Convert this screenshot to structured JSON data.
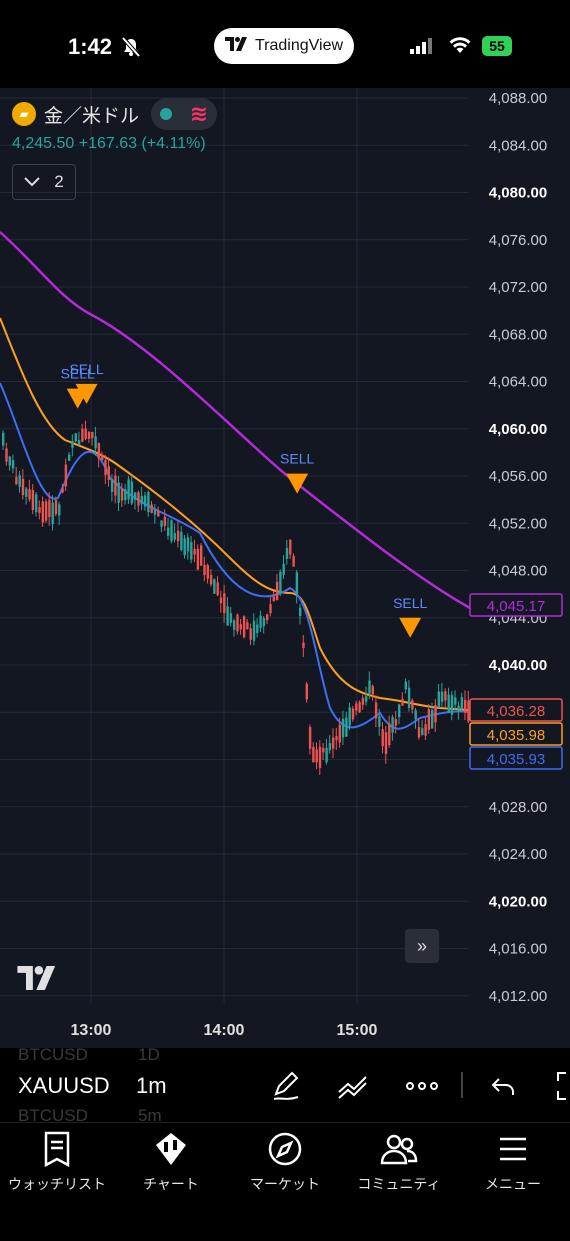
{
  "statusbar": {
    "time": "1:42",
    "app_pill": "TradingView",
    "battery": "55"
  },
  "legend": {
    "symbol_name": "金／米ドル",
    "last_price": "4,245.50",
    "change": "+167.63",
    "change_pct": "(+4.11%)",
    "indicators_count": "2"
  },
  "chart": {
    "colors": {
      "up": "#26a69a",
      "down": "#ef5350",
      "ema_fast": "#3d6ef5",
      "ema_mid": "#ff9f1a",
      "ema_slow": "#b32ad9",
      "grid": "#242936",
      "bg": "#131722"
    },
    "price_axis": [
      "4,088.00",
      "4,084.00",
      "4,080.00",
      "4,076.00",
      "4,072.00",
      "4,068.00",
      "4,064.00",
      "4,060.00",
      "4,056.00",
      "4,052.00",
      "4,048.00",
      "4,044.00",
      "4,040.00",
      "4,036.00",
      "4,032.00",
      "4,028.00",
      "4,024.00",
      "4,020.00",
      "4,016.00",
      "4,012.00"
    ],
    "bold_price_labels": [
      "4,080.00",
      "4,060.00",
      "4,040.00",
      "4,020.00"
    ],
    "time_axis": [
      "13:00",
      "14:00",
      "15:00"
    ],
    "price_tags": [
      {
        "value": "4,045.17",
        "color": "#b32ad9"
      },
      {
        "value": "4,036.28",
        "color": "#ef5350"
      },
      {
        "value": "4,035.98",
        "color": "#ff9f1a"
      },
      {
        "value": "4,035.93",
        "color": "#3d6ef5"
      }
    ],
    "signals": [
      {
        "label": "SELL",
        "time": "12:54",
        "price": 4063.4
      },
      {
        "label": "SELL",
        "time": "12:58",
        "price": 4063.8
      },
      {
        "label": "SELL",
        "time": "14:33",
        "price": 4056.2
      },
      {
        "label": "SELL",
        "time": "15:24",
        "price": 4044.0
      }
    ]
  },
  "toolbar": {
    "symbol": "XAUUSD",
    "interval": "1m",
    "ghost_top_symbol": "BTCUSD",
    "ghost_top_interval": "1D",
    "ghost_bottom_symbol": "BTCUSD",
    "ghost_bottom_interval": "5m"
  },
  "tabs": [
    {
      "label": "ウォッチリスト",
      "icon": "watchlist-icon"
    },
    {
      "label": "チャート",
      "icon": "chart-icon"
    },
    {
      "label": "マーケット",
      "icon": "compass-icon"
    },
    {
      "label": "コミュニティ",
      "icon": "community-icon"
    },
    {
      "label": "メニュー",
      "icon": "menu-icon"
    }
  ]
}
